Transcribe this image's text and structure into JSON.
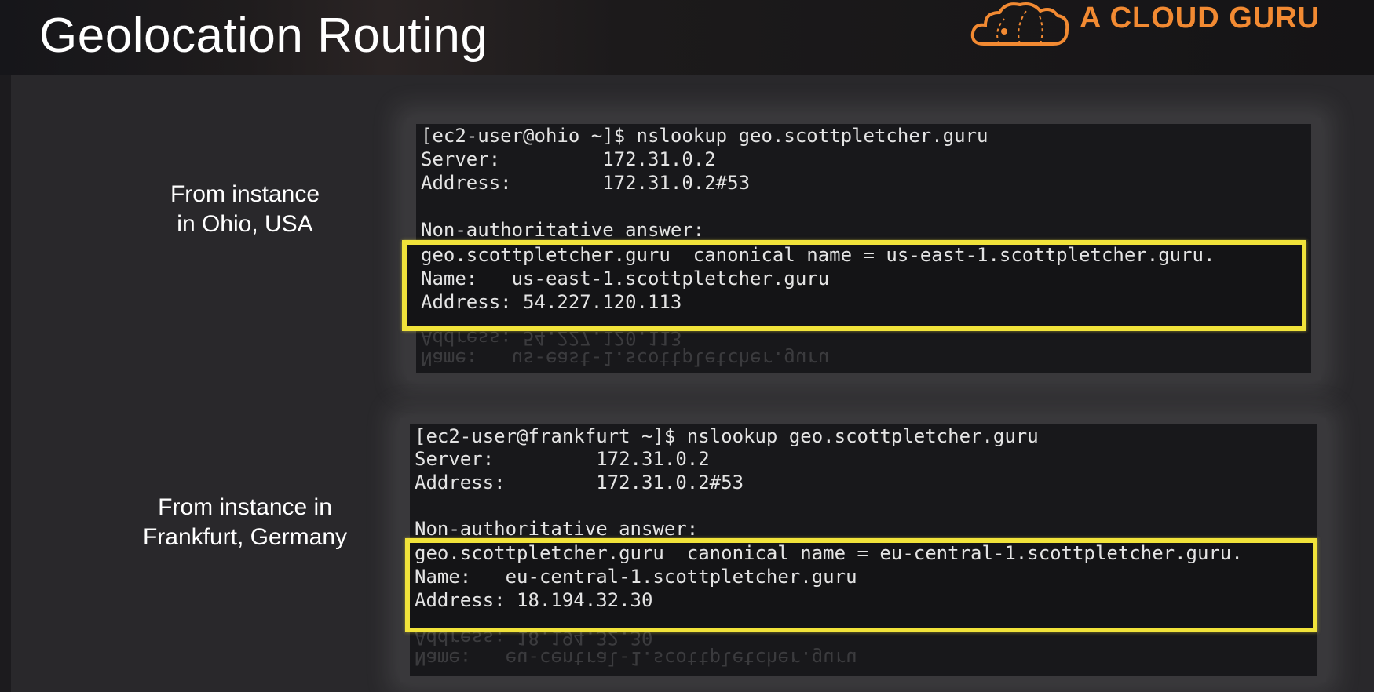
{
  "slide": {
    "title": "Geolocation Routing"
  },
  "logo": {
    "text": "A CLOUD GURU",
    "icon": "cloud-icon",
    "color": "#f28a32"
  },
  "sections": [
    {
      "caption": [
        "From instance",
        "in Ohio, USA"
      ],
      "terminal": {
        "prompt_line": "[ec2-user@ohio ~]$ nslookup geo.scottpletcher.guru",
        "server_line": "Server:         172.31.0.2",
        "address_line": "Address:        172.31.0.2#53",
        "answer_header": "Non-authoritative answer:",
        "answer": [
          "geo.scottpletcher.guru  canonical name = us-east-1.scottpletcher.guru.",
          "Name:   us-east-1.scottpletcher.guru",
          "Address: 54.227.120.113"
        ],
        "reflection": [
          "Address: 54.227.120.113",
          "Name:   us-east-1.scottpletcher.guru"
        ]
      }
    },
    {
      "caption": [
        "From instance in",
        "Frankfurt, Germany"
      ],
      "terminal": {
        "prompt_line": "[ec2-user@frankfurt ~]$ nslookup geo.scottpletcher.guru",
        "server_line": "Server:         172.31.0.2",
        "address_line": "Address:        172.31.0.2#53",
        "answer_header": "Non-authoritative answer:",
        "answer": [
          "geo.scottpletcher.guru  canonical name = eu-central-1.scottpletcher.guru.",
          "Name:   eu-central-1.scottpletcher.guru",
          "Address: 18.194.32.30"
        ],
        "reflection": [
          "Address: 18.194.32.30",
          "Name:   eu-central-1.scottpletcher.guru"
        ]
      }
    }
  ],
  "colors": {
    "highlight": "#f1e33a",
    "terminal_bg": "#18181b",
    "slide_bg": "#29282b"
  }
}
